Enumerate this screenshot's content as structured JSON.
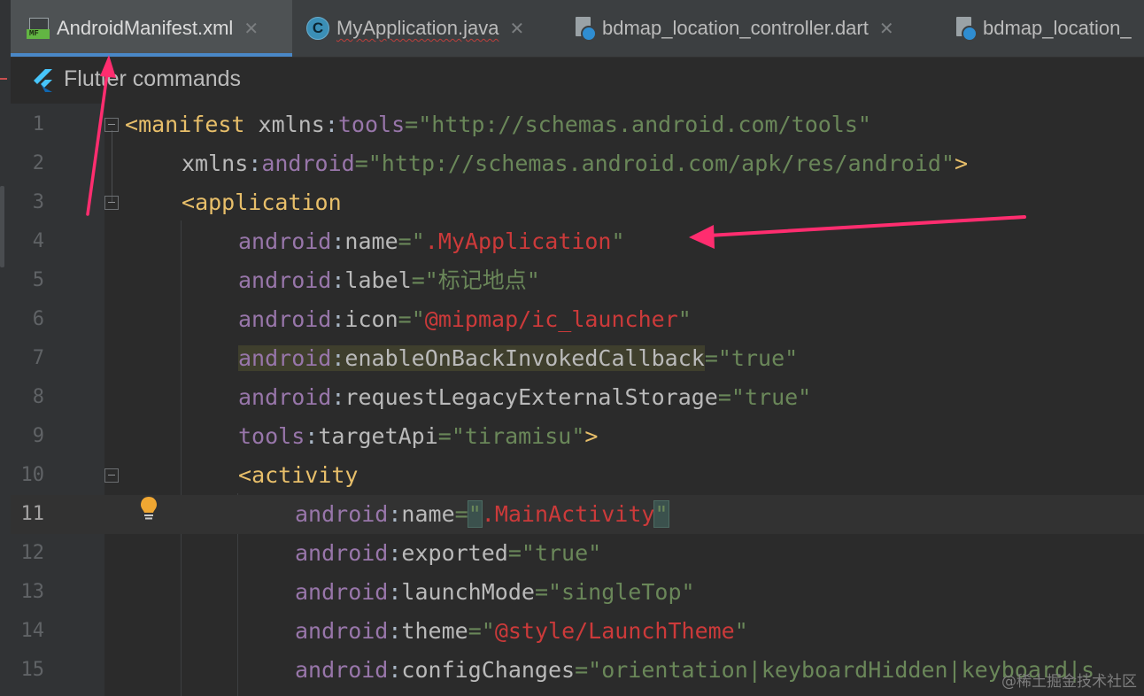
{
  "tabs": [
    {
      "label": "AndroidManifest.xml",
      "icon": "manifest-file-icon",
      "active": true
    },
    {
      "label": "MyApplication.java",
      "icon": "java-class-icon",
      "active": false
    },
    {
      "label": "bdmap_location_controller.dart",
      "icon": "dart-file-icon",
      "active": false
    },
    {
      "label": "bdmap_location_",
      "icon": "dart-file-icon",
      "active": false
    }
  ],
  "toolbar": {
    "label": "Flutter commands",
    "icon": "flutter-icon"
  },
  "editor": {
    "line_numbers": [
      "1",
      "2",
      "3",
      "4",
      "5",
      "6",
      "7",
      "8",
      "9",
      "10",
      "11",
      "12",
      "13",
      "14",
      "15"
    ],
    "current_line": "11",
    "l1": {
      "open": "<",
      "tag": "manifest",
      "sp": " ",
      "ns": "xmlns",
      "colon": ":",
      "attr": "tools",
      "eq": "=",
      "val": "\"http://schemas.android.com/tools\""
    },
    "l2": {
      "ns": "xmlns",
      "colon": ":",
      "attr": "android",
      "eq": "=",
      "val": "\"http://schemas.android.com/apk/res/android\"",
      "close": ">"
    },
    "l3": {
      "open": "<",
      "tag": "application"
    },
    "l4": {
      "prefix": "android",
      "colon": ":",
      "attr": "name",
      "eq": "=",
      "q1": "\"",
      "val": ".MyApplication",
      "q2": "\""
    },
    "l5": {
      "prefix": "android",
      "colon": ":",
      "attr": "label",
      "eq": "=",
      "val": "\"标记地点\""
    },
    "l6": {
      "prefix": "android",
      "colon": ":",
      "attr": "icon",
      "eq": "=",
      "q1": "\"",
      "val": "@mipmap/ic_launcher",
      "q2": "\""
    },
    "l7": {
      "prefix": "android",
      "colon": ":",
      "attr": "enableOnBackInvokedCallback",
      "eq": "=",
      "val": "\"true\""
    },
    "l8": {
      "prefix": "android",
      "colon": ":",
      "attr": "requestLegacyExternalStorage",
      "eq": "=",
      "val": "\"true\""
    },
    "l9": {
      "prefix": "tools",
      "colon": ":",
      "attr": "targetApi",
      "eq": "=",
      "val": "\"tiramisu\"",
      "close": ">"
    },
    "l10": {
      "open": "<",
      "tag": "activity"
    },
    "l11": {
      "prefix": "android",
      "colon": ":",
      "attr": "name",
      "eq": "=",
      "q1": "\"",
      "val": ".MainActivity",
      "q2": "\""
    },
    "l12": {
      "prefix": "android",
      "colon": ":",
      "attr": "exported",
      "eq": "=",
      "val": "\"true\""
    },
    "l13": {
      "prefix": "android",
      "colon": ":",
      "attr": "launchMode",
      "eq": "=",
      "val": "\"singleTop\""
    },
    "l14": {
      "prefix": "android",
      "colon": ":",
      "attr": "theme",
      "eq": "=",
      "q1": "\"",
      "val": "@style/LaunchTheme",
      "q2": "\""
    },
    "l15": {
      "prefix": "android",
      "colon": ":",
      "attr": "configChanges",
      "eq": "=",
      "val": "\"orientation|keyboardHidden|keyboard|s"
    }
  },
  "watermark": "@稀土掘金技术社区",
  "colors": {
    "accent_tab_underline": "#4a88c7",
    "annotation_arrow": "#ff2d6f",
    "xml_tag": "#e8bf6a",
    "xml_attr_prefix": "#9876aa",
    "xml_string": "#6a8759",
    "resource_ref": "#cc3a3a",
    "bulb": "#f0a732"
  }
}
